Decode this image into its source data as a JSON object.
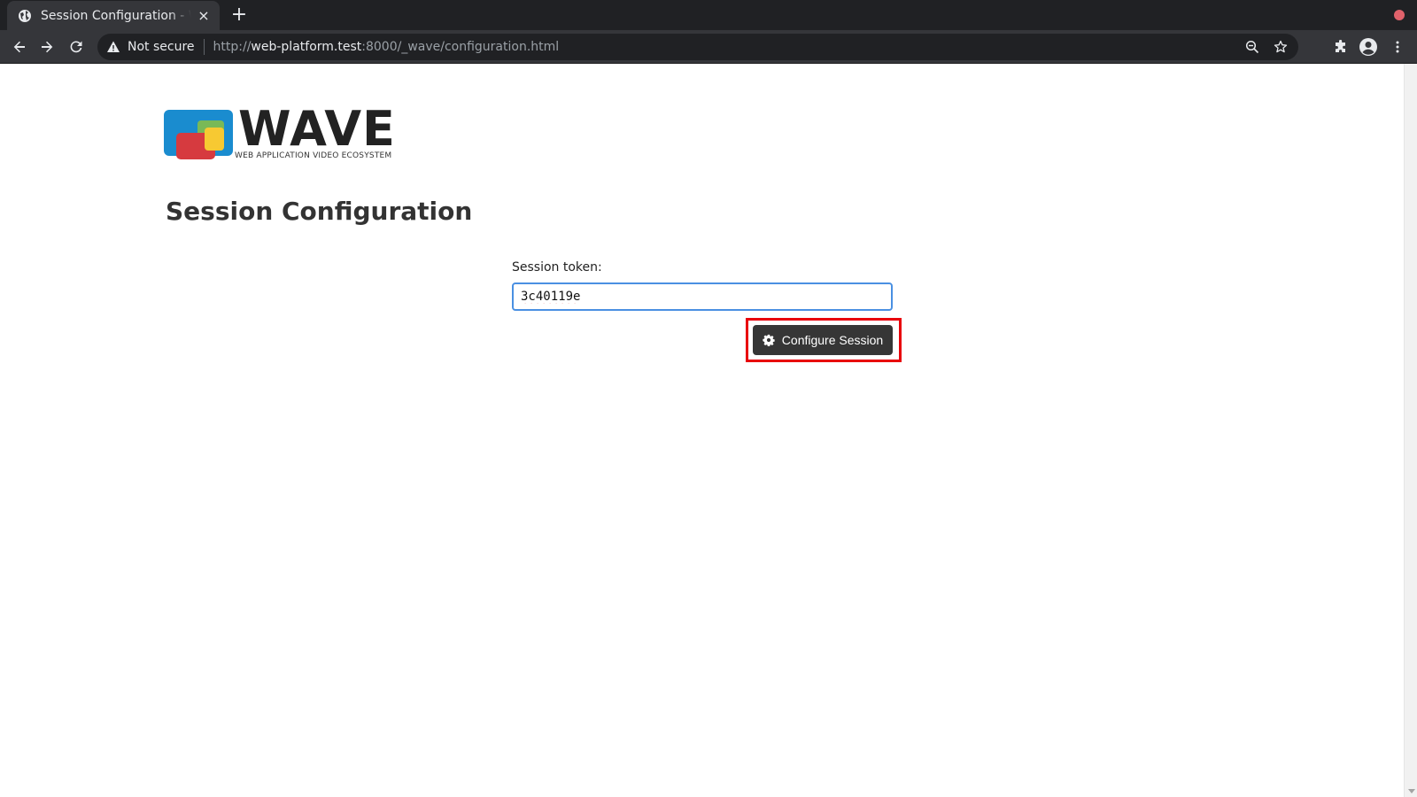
{
  "browser": {
    "tab_title": "Session Configuration - WAVE",
    "new_tab_label": "+",
    "close_label": "×",
    "security_label": "Not secure",
    "url_scheme": "http://",
    "url_host": "web-platform.test",
    "url_path": ":8000/_wave/configuration.html"
  },
  "logo": {
    "wordmark": "WAVE",
    "tagline": "WEB APPLICATION VIDEO ECOSYSTEM"
  },
  "page": {
    "title": "Session Configuration"
  },
  "form": {
    "token_label": "Session token:",
    "token_value": "3c40119e",
    "submit_label": "Configure Session"
  },
  "colors": {
    "button_bg": "#363636",
    "input_border": "#4a90e2",
    "highlight": "#e8000b"
  }
}
